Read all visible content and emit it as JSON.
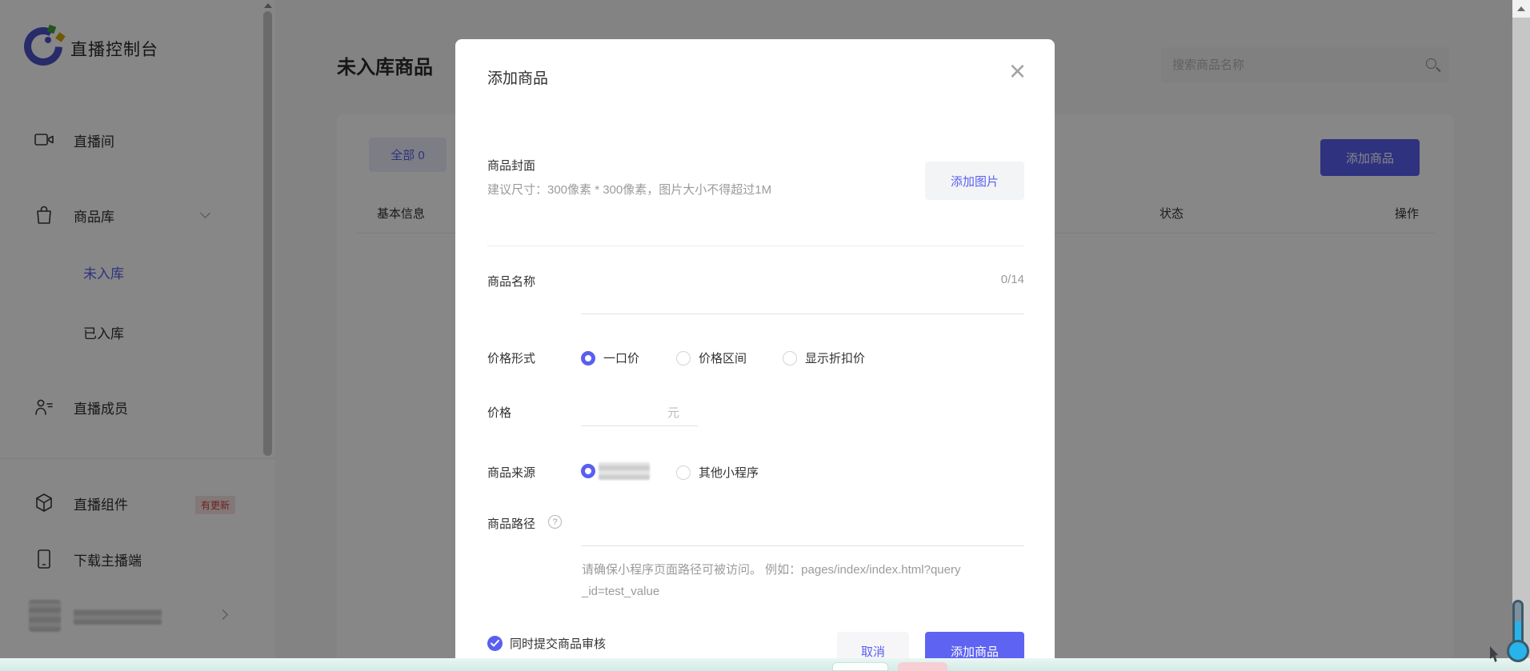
{
  "colors": {
    "accent": "#5a5ff0",
    "update_badge_text": "#cf4040",
    "bottom_strip": "#d9eeea",
    "widget_teal": "#26b4ea"
  },
  "icons": {
    "close": "×",
    "help": "?"
  },
  "sidebar": {
    "app_title": "直播控制台",
    "items": [
      {
        "label": "直播间"
      },
      {
        "label": "商品库"
      },
      {
        "label": "未入库"
      },
      {
        "label": "已入库"
      },
      {
        "label": "直播成员"
      },
      {
        "label": "直播组件",
        "badge": "有更新"
      },
      {
        "label": "下载主播端"
      }
    ]
  },
  "header": {
    "page_title": "未入库商品",
    "search_placeholder": "搜索商品名称"
  },
  "toolbar": {
    "tab_all": "全部 0",
    "add_product": "添加商品"
  },
  "table": {
    "headers": [
      "基本信息",
      "状态",
      "操作"
    ]
  },
  "modal": {
    "title": "添加商品",
    "cover": {
      "label": "商品封面",
      "hint": "建议尺寸：300像素 * 300像素，图片大小不得超过1M",
      "button": "添加图片"
    },
    "name": {
      "label": "商品名称",
      "counter": "0/14"
    },
    "price_type": {
      "label": "价格形式",
      "options": [
        "一口价",
        "价格区间",
        "显示折扣价"
      ],
      "selected": "一口价"
    },
    "price": {
      "label": "价格",
      "unit": "元"
    },
    "source": {
      "label": "商品来源",
      "option2": "其他小程序"
    },
    "path": {
      "label": "商品路径",
      "hint_line1": "请确保小程序页面路径可被访问。 例如：pages/index/index.html?query",
      "hint_line2": "_id=test_value"
    },
    "review_checkbox": "同时提交商品审核",
    "cancel": "取消",
    "submit": "添加商品"
  }
}
